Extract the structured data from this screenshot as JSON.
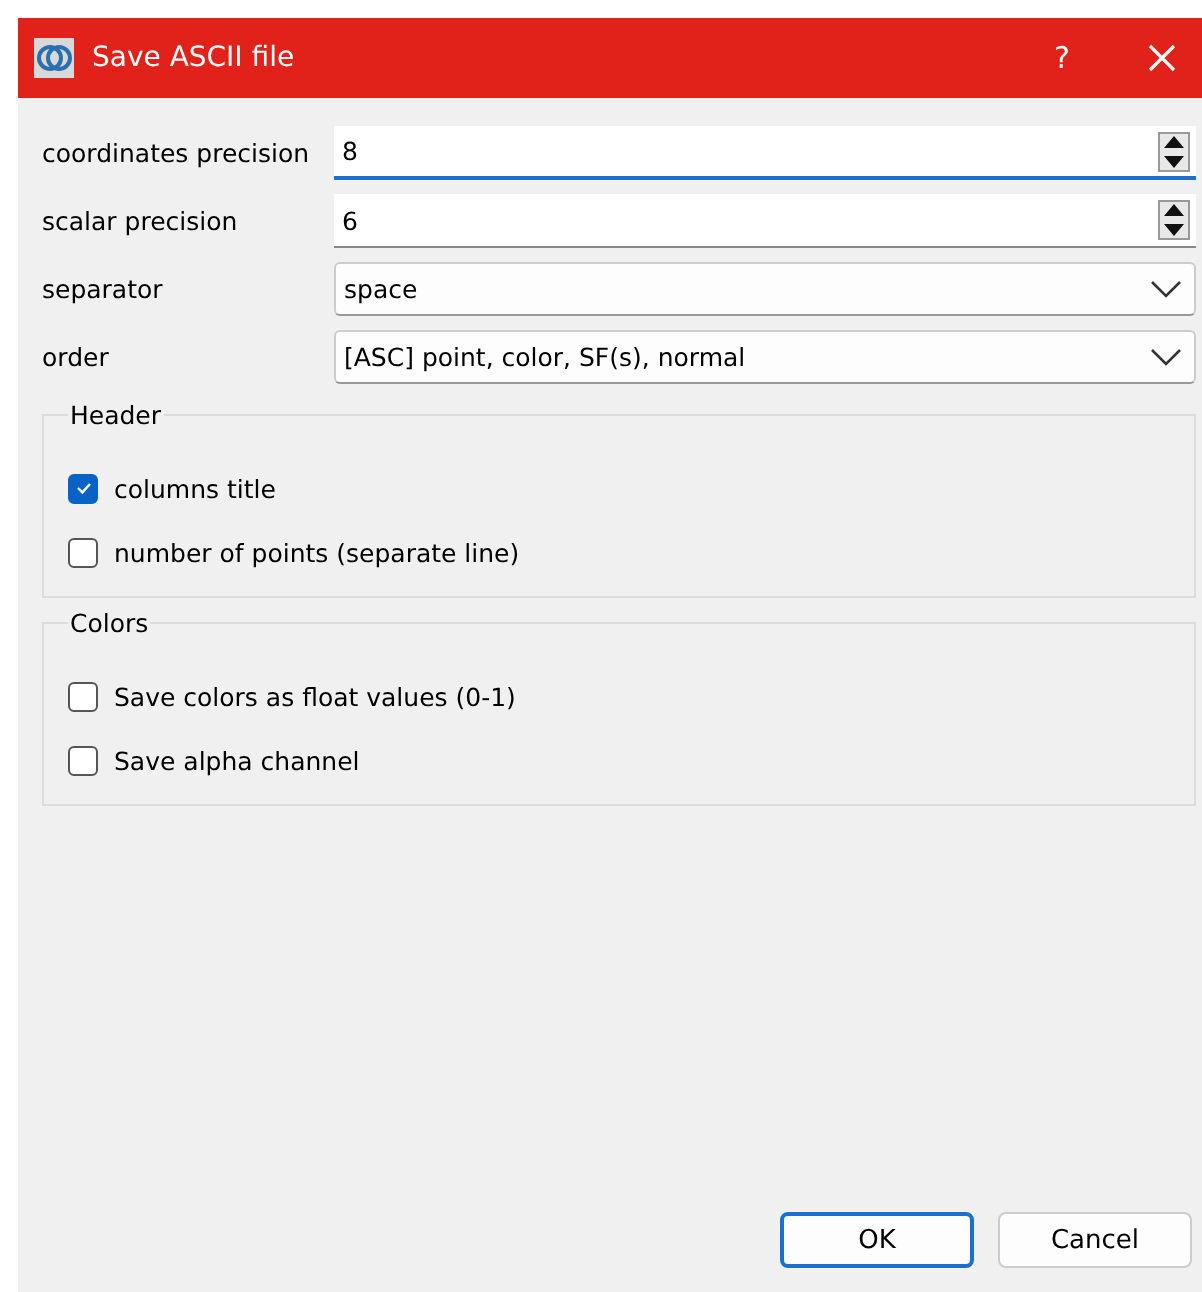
{
  "window": {
    "title": "Save ASCII file",
    "help": "?"
  },
  "fields": [
    {
      "label": "coordinates precision",
      "kind": "spin",
      "value": "8",
      "focused": true
    },
    {
      "label": "scalar precision",
      "kind": "spin",
      "value": "6",
      "focused": false
    },
    {
      "label": "separator",
      "kind": "combo",
      "value": "space",
      "focused": false
    },
    {
      "label": "order",
      "kind": "combo",
      "value": "[ASC] point, color, SF(s), normal",
      "focused": false
    }
  ],
  "groups": [
    {
      "title": "Header",
      "options": [
        {
          "label": "columns title",
          "checked": true
        },
        {
          "label": "number of points (separate line)",
          "checked": false
        }
      ]
    },
    {
      "title": "Colors",
      "options": [
        {
          "label": "Save colors as float values (0-1)",
          "checked": false
        },
        {
          "label": "Save alpha channel",
          "checked": false
        }
      ]
    }
  ],
  "buttons": [
    {
      "label": "OK",
      "default": true
    },
    {
      "label": "Cancel",
      "default": false
    }
  ]
}
